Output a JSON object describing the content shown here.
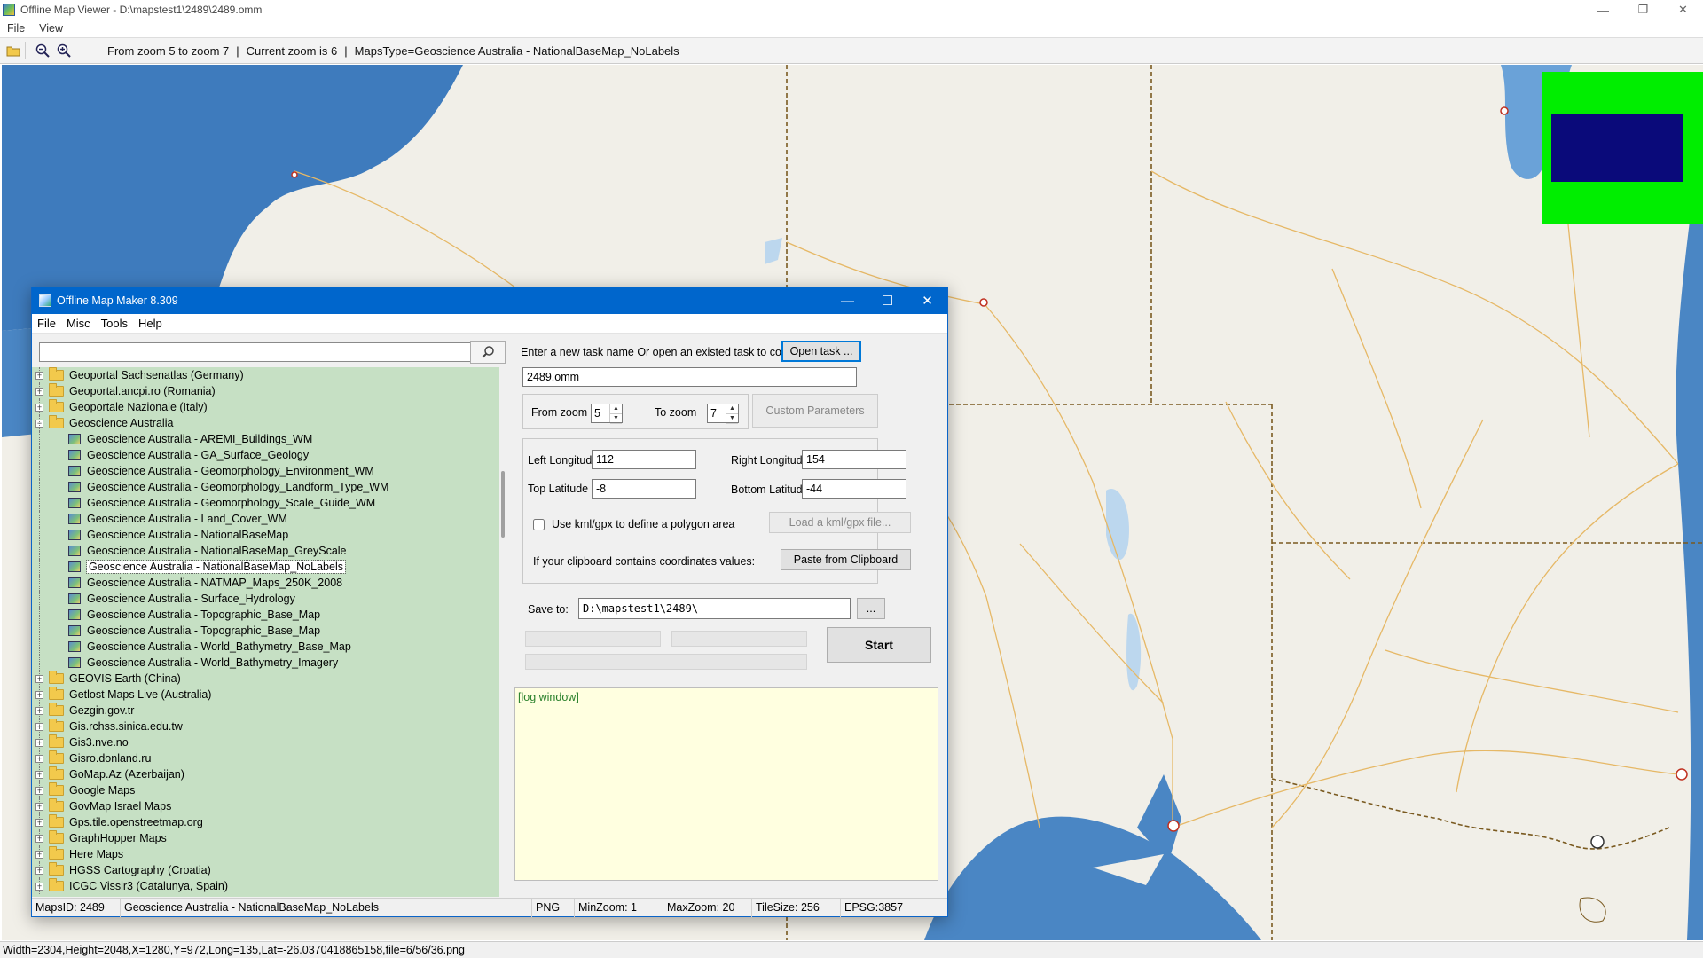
{
  "app": {
    "title": "Offline Map Viewer - D:\\mapstest1\\2489\\2489.omm",
    "menu": [
      "File",
      "View"
    ],
    "window_controls": [
      "—",
      "❐",
      "✕"
    ]
  },
  "toolbar": {
    "icons": [
      "open-folder-icon",
      "zoom-out-icon",
      "zoom-in-icon"
    ],
    "zoom_range": "From zoom 5 to zoom 7",
    "separator1": "|",
    "current_zoom": "Current zoom is 6",
    "separator2": "|",
    "maps_type": "MapsType=Geoscience Australia - NationalBaseMap_NoLabels"
  },
  "status": "Width=2304,Height=2048,X=1280,Y=972,Long=135,Lat=-26.0370418865158,file=6/56/36.png",
  "map": {
    "colors": {
      "land": "#f1efe8",
      "ocean": "#3e7bbd",
      "road": "#e6b866",
      "border": "#7a5a20",
      "lake": "#bcd7ee"
    }
  },
  "overview": {
    "frame_color": "#00ee00",
    "view_color": "#0a0a7a"
  },
  "dialog": {
    "title": "Offline Map Maker 8.309",
    "controls": [
      "—",
      "☐",
      "✕"
    ],
    "menu": {
      "file": "File",
      "misc": "Misc",
      "tools": "Tools",
      "help": "Help"
    },
    "search": {
      "value": ""
    },
    "tree": [
      {
        "label": "Geoportal Sachsenatlas (Germany)",
        "type": "folder",
        "expanded": false
      },
      {
        "label": "Geoportal.ancpi.ro (Romania)",
        "type": "folder",
        "expanded": false
      },
      {
        "label": "Geoportale Nazionale (Italy)",
        "type": "folder",
        "expanded": false
      },
      {
        "label": "Geoscience Australia",
        "type": "folder",
        "expanded": true
      },
      {
        "label": "Geoscience Australia - AREMI_Buildings_WM",
        "type": "map"
      },
      {
        "label": "Geoscience Australia - GA_Surface_Geology",
        "type": "map"
      },
      {
        "label": "Geoscience Australia - Geomorphology_Environment_WM",
        "type": "map"
      },
      {
        "label": "Geoscience Australia - Geomorphology_Landform_Type_WM",
        "type": "map"
      },
      {
        "label": "Geoscience Australia - Geomorphology_Scale_Guide_WM",
        "type": "map"
      },
      {
        "label": "Geoscience Australia - Land_Cover_WM",
        "type": "map"
      },
      {
        "label": "Geoscience Australia - NationalBaseMap",
        "type": "map"
      },
      {
        "label": "Geoscience Australia - NationalBaseMap_GreyScale",
        "type": "map"
      },
      {
        "label": "Geoscience Australia - NationalBaseMap_NoLabels",
        "type": "map",
        "selected": true
      },
      {
        "label": "Geoscience Australia - NATMAP_Maps_250K_2008",
        "type": "map"
      },
      {
        "label": "Geoscience Australia - Surface_Hydrology",
        "type": "map"
      },
      {
        "label": "Geoscience Australia - Topographic_Base_Map",
        "type": "map"
      },
      {
        "label": "Geoscience Australia - Topographic_Base_Map",
        "type": "map"
      },
      {
        "label": "Geoscience Australia - World_Bathymetry_Base_Map",
        "type": "map"
      },
      {
        "label": "Geoscience Australia - World_Bathymetry_Imagery",
        "type": "map"
      },
      {
        "label": "GEOVIS Earth (China)",
        "type": "folder",
        "expanded": false
      },
      {
        "label": "Getlost Maps Live (Australia)",
        "type": "folder",
        "expanded": false
      },
      {
        "label": "Gezgin.gov.tr",
        "type": "folder",
        "expanded": false
      },
      {
        "label": "Gis.rchss.sinica.edu.tw",
        "type": "folder",
        "expanded": false
      },
      {
        "label": "Gis3.nve.no",
        "type": "folder",
        "expanded": false
      },
      {
        "label": "Gisro.donland.ru",
        "type": "folder",
        "expanded": false
      },
      {
        "label": "GoMap.Az (Azerbaijan)",
        "type": "folder",
        "expanded": false
      },
      {
        "label": "Google Maps",
        "type": "folder",
        "expanded": false
      },
      {
        "label": "GovMap Israel Maps",
        "type": "folder",
        "expanded": false
      },
      {
        "label": "Gps.tile.openstreetmap.org",
        "type": "folder",
        "expanded": false
      },
      {
        "label": "GraphHopper Maps",
        "type": "folder",
        "expanded": false
      },
      {
        "label": "Here Maps",
        "type": "folder",
        "expanded": false
      },
      {
        "label": "HGSS Cartography (Croatia)",
        "type": "folder",
        "expanded": false
      },
      {
        "label": "ICGC Vissir3 (Catalunya, Spain)",
        "type": "folder",
        "expanded": false
      }
    ],
    "task": {
      "prompt": "Enter a new task name Or open an existed task to continue:",
      "open_button": "Open task ...",
      "name_value": "2489.omm"
    },
    "zoom": {
      "from_label": "From zoom",
      "from_value": "5",
      "to_label": "To zoom",
      "to_value": "7",
      "custom_button": "Custom Parameters"
    },
    "coords": {
      "left_lon_label": "Left Longitude",
      "left_lon_value": "112",
      "right_lon_label": "Right Longitude",
      "right_lon_value": "154",
      "top_lat_label": "Top Latitude",
      "top_lat_value": "-8",
      "bottom_lat_label": "Bottom Latitude",
      "bottom_lat_value": "-44",
      "kml_checkbox_label": "Use kml/gpx to define a polygon area",
      "kml_checked": false,
      "kml_button": "Load a kml/gpx file...",
      "clipboard_label": "If your clipboard contains coordinates values:",
      "clipboard_button": "Paste from Clipboard"
    },
    "save": {
      "label": "Save to:",
      "value": "D:\\mapstest1\\2489\\",
      "browse": "..."
    },
    "start_button": "Start",
    "log_label": "[log window]",
    "status": {
      "maps_id": "MapsID: 2489",
      "maps_name": "Geoscience Australia - NationalBaseMap_NoLabels",
      "format": "PNG",
      "min_zoom": "MinZoom: 1",
      "max_zoom": "MaxZoom: 20",
      "tile_size": "TileSize: 256",
      "epsg": "EPSG:3857"
    }
  }
}
